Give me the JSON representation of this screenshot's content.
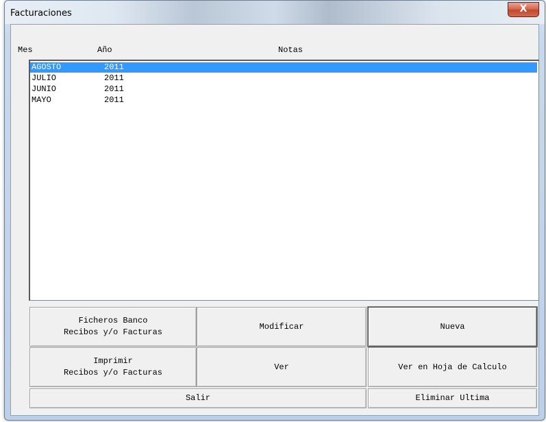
{
  "window": {
    "title": "Facturaciones",
    "close_label": "X"
  },
  "columns": {
    "mes": "Mes",
    "anio": "Año",
    "notas": "Notas"
  },
  "rows": [
    {
      "mes": "AGOSTO",
      "anio": "2011",
      "notas": "",
      "selected": true
    },
    {
      "mes": "JULIO",
      "anio": "2011",
      "notas": ""
    },
    {
      "mes": "JUNIO",
      "anio": "2011",
      "notas": ""
    },
    {
      "mes": "MAYO",
      "anio": "2011",
      "notas": ""
    }
  ],
  "buttons": {
    "ficheros_line1": "Ficheros Banco",
    "ficheros_line2": "Recibos y/o Facturas",
    "modificar": "Modificar",
    "nueva": "Nueva",
    "imprimir_line1": "Imprimir",
    "imprimir_line2": "Recibos y/o Facturas",
    "ver": "Ver",
    "ver_hoja": "Ver en Hoja de Calculo",
    "salir": "Salir",
    "eliminar": "Eliminar Ultima"
  },
  "colors": {
    "selection": "#3399ff",
    "close_button": "#c2472d"
  }
}
